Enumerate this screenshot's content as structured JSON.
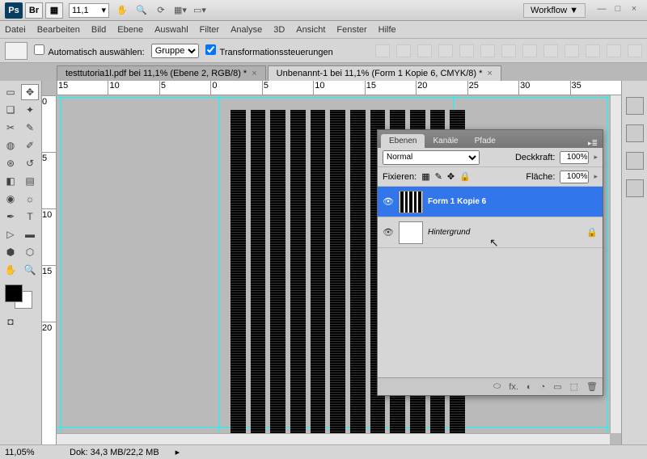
{
  "titlebar": {
    "logo": "Ps",
    "aux1": "Br",
    "aux2": "▦",
    "zoom": "11,1",
    "workflow": "Workflow ▼"
  },
  "menu": [
    "Datei",
    "Bearbeiten",
    "Bild",
    "Ebene",
    "Auswahl",
    "Filter",
    "Analyse",
    "3D",
    "Ansicht",
    "Fenster",
    "Hilfe"
  ],
  "options": {
    "auto_select": "Automatisch auswählen:",
    "group": "Gruppe",
    "transform": "Transformationssteuerungen"
  },
  "tabs": [
    {
      "label": "testtutoria1l.pdf bei 11,1% (Ebene 2, RGB/8) *",
      "active": false
    },
    {
      "label": "Unbenannt-1 bei 11,1% (Form 1 Kopie 6, CMYK/8) *",
      "active": true
    }
  ],
  "ruler_h": [
    "15",
    "10",
    "5",
    "0",
    "5",
    "10",
    "15",
    "20",
    "25",
    "30",
    "35"
  ],
  "ruler_v": [
    "0",
    "5",
    "10",
    "15",
    "20"
  ],
  "layerspanel": {
    "tabs": [
      "Ebenen",
      "Kanäle",
      "Pfade"
    ],
    "blend": "Normal",
    "opacity_label": "Deckkraft:",
    "opacity": "100%",
    "lock_label": "Fixieren:",
    "fill_label": "Fläche:",
    "fill": "100%",
    "layers": [
      {
        "name": "Form 1 Kopie 6",
        "selected": true,
        "locked": false,
        "italic": false
      },
      {
        "name": "Hintergrund",
        "selected": false,
        "locked": true,
        "italic": true
      }
    ],
    "footer_icons": [
      "⬭",
      "fx.",
      "◐",
      "◔",
      "▭",
      "⬚",
      "🗑"
    ]
  },
  "status": {
    "zoom": "11,05%",
    "doc": "Dok: 34,3 MB/22,2 MB"
  }
}
